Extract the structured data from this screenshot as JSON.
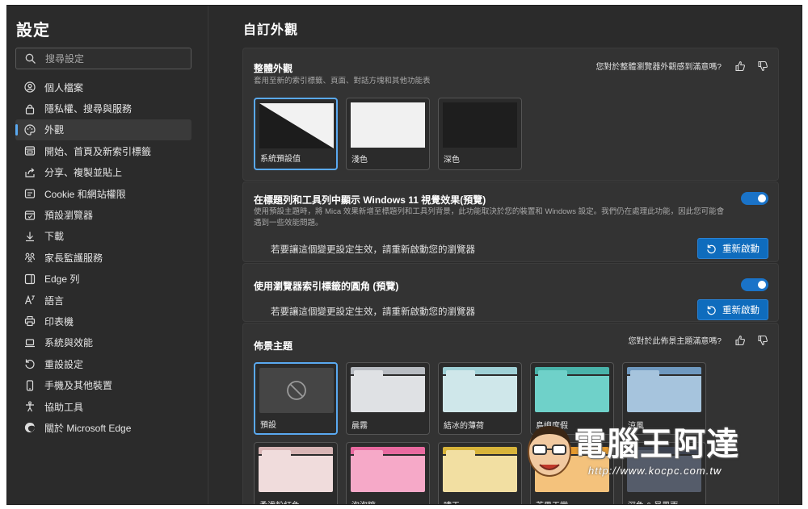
{
  "sidebar": {
    "title": "設定",
    "search_placeholder": "搜尋設定",
    "items": [
      {
        "label": "個人檔案",
        "icon": "profile-icon"
      },
      {
        "label": "隱私權、搜尋與服務",
        "icon": "lock-icon"
      },
      {
        "label": "外觀",
        "icon": "palette-icon",
        "active": true
      },
      {
        "label": "開始、首頁及新索引標籤",
        "icon": "home-tab-icon"
      },
      {
        "label": "分享、複製並貼上",
        "icon": "share-icon"
      },
      {
        "label": "Cookie 和網站權限",
        "icon": "site-permissions-icon"
      },
      {
        "label": "預設瀏覽器",
        "icon": "default-browser-icon"
      },
      {
        "label": "下載",
        "icon": "download-icon"
      },
      {
        "label": "家長監護服務",
        "icon": "family-icon"
      },
      {
        "label": "Edge 列",
        "icon": "edge-bar-icon"
      },
      {
        "label": "語言",
        "icon": "language-icon"
      },
      {
        "label": "印表機",
        "icon": "printer-icon"
      },
      {
        "label": "系統與效能",
        "icon": "laptop-icon"
      },
      {
        "label": "重設設定",
        "icon": "reset-icon"
      },
      {
        "label": "手機及其他裝置",
        "icon": "phone-icon"
      },
      {
        "label": "協助工具",
        "icon": "accessibility-icon"
      },
      {
        "label": "關於 Microsoft Edge",
        "icon": "edge-logo-icon"
      }
    ]
  },
  "main": {
    "title": "自訂外觀",
    "overall": {
      "heading": "整體外觀",
      "description": "套用至新的索引標籤、頁面、對話方塊和其他功能表",
      "feedback_question": "您對於整體瀏覽器外觀感到滿意嗎?",
      "options": [
        {
          "label": "系統預設值",
          "selected": true
        },
        {
          "label": "淺色",
          "selected": false
        },
        {
          "label": "深色",
          "selected": false
        }
      ]
    },
    "mica": {
      "heading": "在標題列和工具列中顯示 Windows 11 視覺效果(預覽)",
      "description_line1": "使用預設主題時，將 Mica 效果新增至標題列和工具列背景，此功能取決於您的裝置和 Windows 設定。我們仍在處理此功能，因此您可能會",
      "description_line2": "遇到一些效能問題。",
      "enabled": true,
      "restart_note": "若要讓這個變更設定生效，請重新啟動您的瀏覽器",
      "restart_label": "重新啟動"
    },
    "rounded_tabs": {
      "heading": "使用瀏覽器索引標籤的圓角 (預覽)",
      "enabled": true,
      "restart_note": "若要讓這個變更設定生效，請重新啟動您的瀏覽器",
      "restart_label": "重新啟動"
    },
    "themes": {
      "heading": "佈景主題",
      "feedback_question": "您對於此佈景主題滿意嗎?",
      "items": [
        {
          "label": "預設",
          "selected": true,
          "tab": "#505050",
          "body": "#454545"
        },
        {
          "label": "晨霧",
          "tab": "#b8bcc2",
          "body": "#dfe1e4"
        },
        {
          "label": "結冰的薄荷",
          "tab": "#9fd0d6",
          "body": "#cfe7ea"
        },
        {
          "label": "島嶼度假",
          "tab": "#49b3aa",
          "body": "#6fd1c9"
        },
        {
          "label": "涼風",
          "tab": "#6f99c0",
          "body": "#a6c4dd"
        },
        {
          "label": "柔滑粉紅色",
          "tab": "#d8b5b5",
          "body": "#f0dcdc"
        },
        {
          "label": "泡泡糖",
          "tab": "#e96aa0",
          "body": "#f6a9c8"
        },
        {
          "label": "晴天",
          "tab": "#d8b43a",
          "body": "#f2dfa2"
        },
        {
          "label": "芒果天堂",
          "tab": "#e59a2e",
          "body": "#f4c27c"
        },
        {
          "label": "深色 & 暴風雨",
          "tab": "#3d4350",
          "body": "#555c6a"
        }
      ]
    }
  },
  "watermark": {
    "text": "電腦王阿達",
    "url": "http://www.kocpc.com.tw"
  }
}
